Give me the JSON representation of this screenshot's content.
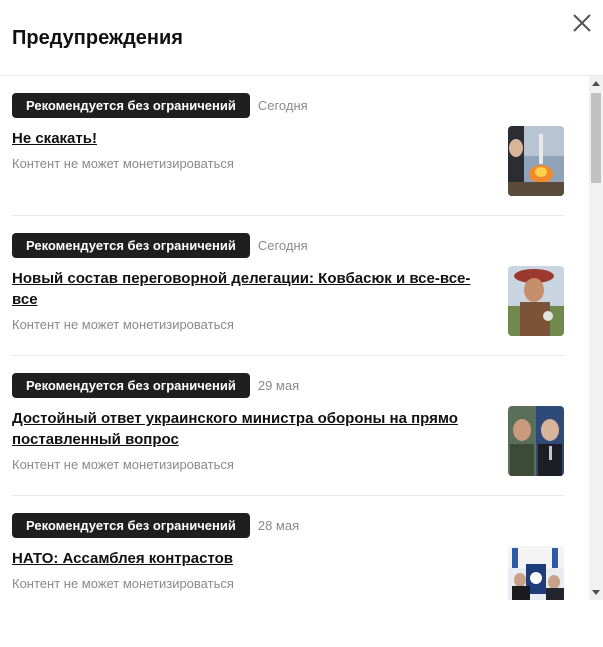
{
  "dialog": {
    "title": "Предупреждения"
  },
  "items": [
    {
      "badge": "Рекомендуется без ограничений",
      "date": "Сегодня",
      "headline": "Не скакать!",
      "status": "Контент не может монетизироваться",
      "thumb_icon": "rocket-launch-photo"
    },
    {
      "badge": "Рекомендуется без ограничений",
      "date": "Сегодня",
      "headline": "Новый состав переговорной делегации: Ковбасюк и все-все-все",
      "status": "Контент не может монетизироваться",
      "thumb_icon": "costumed-man-photo"
    },
    {
      "badge": "Рекомендуется без ограничений",
      "date": "29 мая",
      "headline": "Достойный ответ украинского министра обороны на прямо поставленный вопрос",
      "status": "Контент не может монетизироваться",
      "thumb_icon": "two-portraits-photo"
    },
    {
      "badge": "Рекомендуется без ограничений",
      "date": "28 мая",
      "headline": "НАТО: Ассамблея контрастов",
      "status": "Контент не может монетизироваться",
      "thumb_icon": "nato-assembly-photo"
    }
  ],
  "colors": {
    "badge_bg": "#1f1f1f",
    "muted_text": "#8a8a8a",
    "divider": "#e6e6e6"
  }
}
